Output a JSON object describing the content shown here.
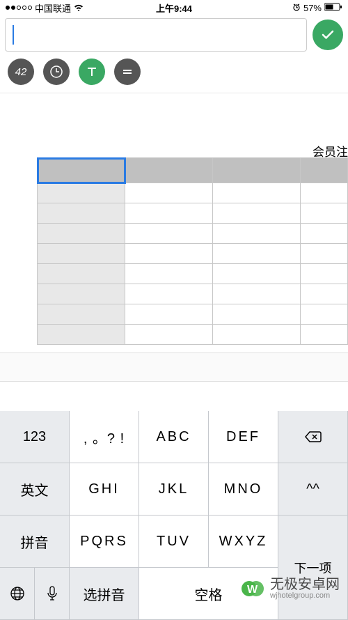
{
  "status": {
    "carrier": "中国联通",
    "time": "上午9:44",
    "battery": "57%"
  },
  "sheet": {
    "title": "会员注"
  },
  "toolbar": {
    "btn1": "42"
  },
  "keyboard": {
    "r1k1": "123",
    "r1k2": ", 。? !",
    "r1k3": "ABC",
    "r1k4": "DEF",
    "r2k1": "英文",
    "r2k2": "GHI",
    "r2k3": "JKL",
    "r2k4": "MNO",
    "r2k5": "^^",
    "r3k1": "拼音",
    "r3k2": "PQRS",
    "r3k3": "TUV",
    "r3k4": "WXYZ",
    "next": "下一项",
    "select": "选拼音",
    "space": "空格"
  },
  "watermark": {
    "main": "无极安卓网",
    "sub": "wjhotelgroup.com"
  }
}
